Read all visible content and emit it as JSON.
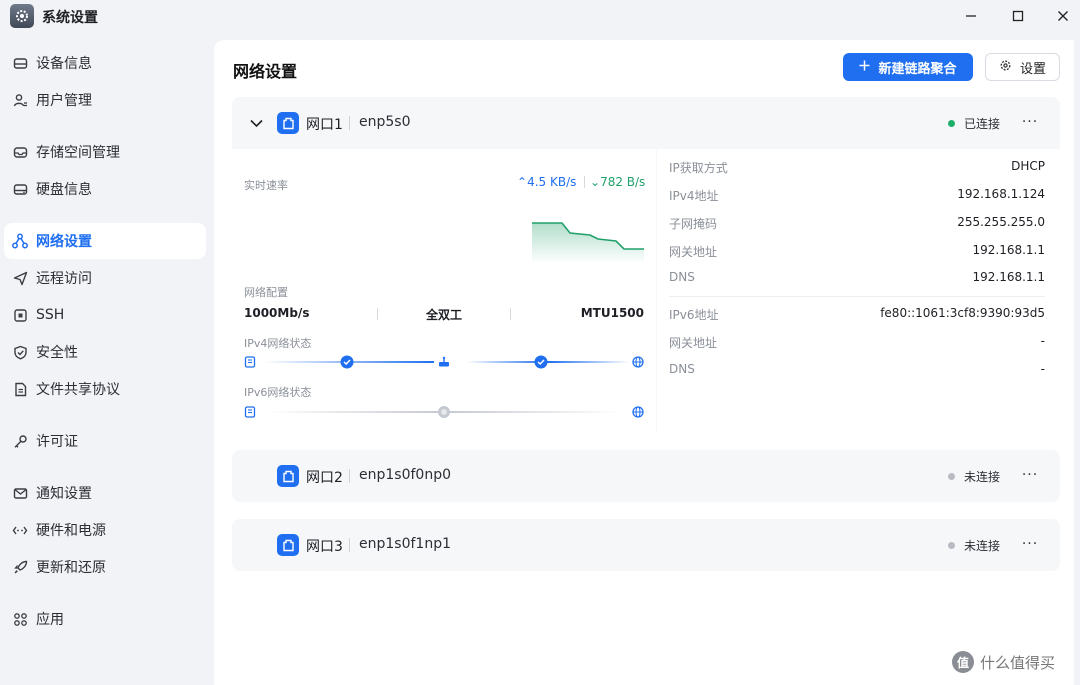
{
  "window": {
    "title": "系统设置",
    "icon": "gear-icon"
  },
  "sidebar": {
    "items": [
      {
        "label": "设备信息",
        "icon": "hdd-icon",
        "active": false
      },
      {
        "label": "用户管理",
        "icon": "user-icon",
        "active": false
      },
      {
        "label": "存储空间管理",
        "icon": "storage-icon",
        "active": false
      },
      {
        "label": "硬盘信息",
        "icon": "disk-icon",
        "active": false
      },
      {
        "label": "网络设置",
        "icon": "network-icon",
        "active": true
      },
      {
        "label": "远程访问",
        "icon": "send-icon",
        "active": false
      },
      {
        "label": "SSH",
        "icon": "terminal-icon",
        "active": false
      },
      {
        "label": "安全性",
        "icon": "shield-icon",
        "active": false
      },
      {
        "label": "文件共享协议",
        "icon": "file-icon",
        "active": false
      },
      {
        "label": "许可证",
        "icon": "key-icon",
        "active": false
      },
      {
        "label": "通知设置",
        "icon": "mail-icon",
        "active": false
      },
      {
        "label": "硬件和电源",
        "icon": "hardware-icon",
        "active": false
      },
      {
        "label": "更新和还原",
        "icon": "rocket-icon",
        "active": false
      },
      {
        "label": "应用",
        "icon": "apps-icon",
        "active": false
      }
    ]
  },
  "main": {
    "title": "网络设置",
    "new_aggregation_label": "新建链路聚合",
    "settings_label": "设置"
  },
  "ports": [
    {
      "name": "网口1",
      "iface": "enp5s0",
      "status": "已连接",
      "status_color": "#1fae6a",
      "expanded": true,
      "realtime_label": "实时速率",
      "upload": "4.5 KB/s",
      "download": "782 B/s",
      "config_label": "网络配置",
      "speed": "1000Mb/s",
      "duplex": "全双工",
      "mtu": "MTU1500",
      "ipv4_status_label": "IPv4网络状态",
      "ipv6_status_label": "IPv6网络状态",
      "info": [
        {
          "k": "IP获取方式",
          "v": "DHCP"
        },
        {
          "k": "IPv4地址",
          "v": "192.168.1.124"
        },
        {
          "k": "子网掩码",
          "v": "255.255.255.0"
        },
        {
          "k": "网关地址",
          "v": "192.168.1.1"
        },
        {
          "k": "DNS",
          "v": "192.168.1.1"
        }
      ],
      "info6": [
        {
          "k": "IPv6地址",
          "v": "fe80::1061:3cf8:9390:93d5"
        },
        {
          "k": "网关地址",
          "v": "-"
        },
        {
          "k": "DNS",
          "v": "-"
        }
      ]
    },
    {
      "name": "网口2",
      "iface": "enp1s0f0np0",
      "status": "未连接",
      "status_color": "#b8bbc1",
      "expanded": false
    },
    {
      "name": "网口3",
      "iface": "enp1s0f1np1",
      "status": "未连接",
      "status_color": "#b8bbc1",
      "expanded": false
    }
  ],
  "watermark": {
    "text": "什么值得买",
    "icon_text": "值"
  },
  "colors": {
    "accent": "#1f6ff0",
    "success": "#1fae6a",
    "download": "#20a06a"
  }
}
